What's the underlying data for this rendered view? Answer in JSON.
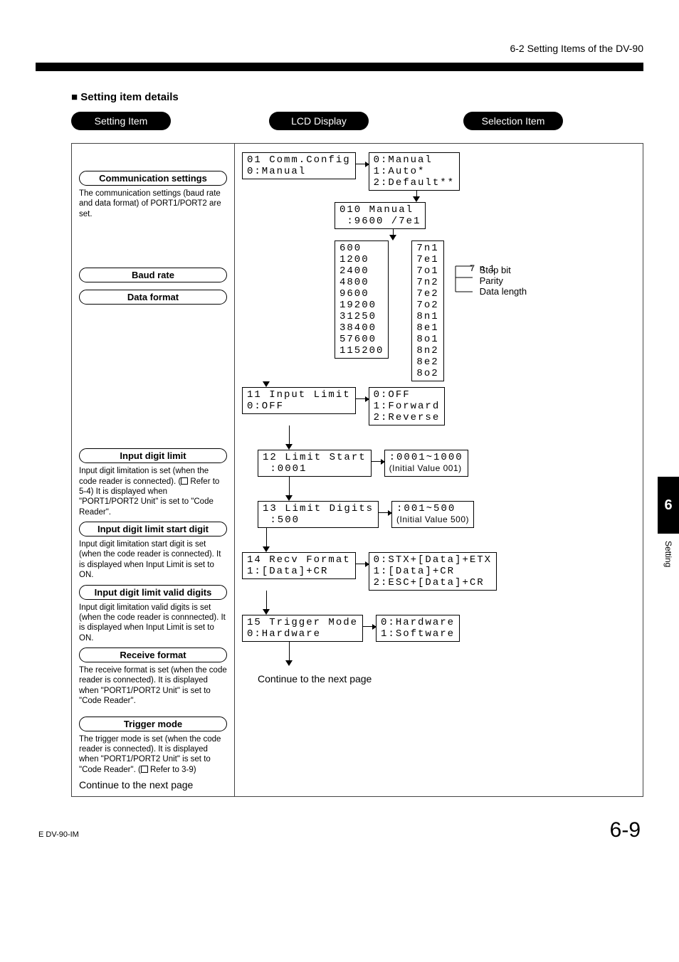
{
  "page_header": "6-2  Setting Items of the DV-90",
  "section_title": "Setting item details",
  "column_headers": {
    "setting": "Setting Item",
    "lcd": "LCD Display",
    "selection": "Selection Item"
  },
  "side": {
    "chapter": "6",
    "label": "Setting"
  },
  "footer": {
    "left": "E DV-90-IM",
    "right": "6-9"
  },
  "continue": "Continue to the next page",
  "left": {
    "comm": {
      "title": "Communication settings",
      "desc": "The communication settings (baud rate and data format) of PORT1/PORT2 are set."
    },
    "baud": {
      "title": "Baud rate"
    },
    "dataformat": {
      "title": "Data format"
    },
    "inputlimit": {
      "title": "Input digit limit",
      "desc": "Input digit limitation is set (when the code reader is connected). ( Refer to 5-4) It is displayed when \"PORT1/PORT2 Unit\" is set to \"Code Reader\"."
    },
    "limitstart": {
      "title": "Input digit limit start digit",
      "desc": "Input digit limitation start digit is set (when the code reader is connected). It is displayed when Input Limit is set to ON."
    },
    "limitdigits": {
      "title": "Input digit limit valid digits",
      "desc": "Input digit limitation valid digits is set (when the code reader is connnected). It is displayed when Input Limit is set to ON."
    },
    "recv": {
      "title": "Receive format",
      "desc": "The receive format is set (when the code reader is connected). It is displayed when \"PORT1/PORT2 Unit\" is set to \"Code Reader\"."
    },
    "trigger": {
      "title": "Trigger mode",
      "desc": "The trigger mode is set (when the code reader is connected). It is displayed when \"PORT1/PORT2 Unit\" is set to \"Code Reader\". ( Refer to 3-9)"
    }
  },
  "lcd": {
    "comm": "01 Comm.Config\n0:Manual",
    "manual": "010 Manual\n :9600 /7e1",
    "inputlimit": "11 Input Limit\n0:OFF",
    "limitstart": "12 Limit Start\n :0001",
    "limitdigits": "13 Limit Digits\n :500",
    "recv": "14 Recv Format\n1:[Data]+CR",
    "trigger": "15 Trigger Mode\n0:Hardware"
  },
  "sel": {
    "comm": "0:Manual\n1:Auto*\n2:Default**",
    "baud": "600\n1200\n2400\n4800\n9600\n19200\n31250\n38400\n57600\n115200",
    "dataformat": "7n1\n7e1\n7o1\n7n2\n7e2\n7o2\n8n1\n8e1\n8o1\n8n2\n8e2\n8o2",
    "df_example": "7n1",
    "df_annot": {
      "a": "Stop bit",
      "b": "Parity",
      "c": "Data length"
    },
    "inputlimit": "0:OFF\n1:Forward\n2:Reverse",
    "limitstart": ":0001~1000",
    "limitstart_sub": "(Initial Value 001)",
    "limitdigits": ":001~500",
    "limitdigits_sub": "(Initial Value 500)",
    "recv": "0:STX+[Data]+ETX\n1:[Data]+CR\n2:ESC+[Data]+CR",
    "trigger": "0:Hardware\n1:Software"
  }
}
